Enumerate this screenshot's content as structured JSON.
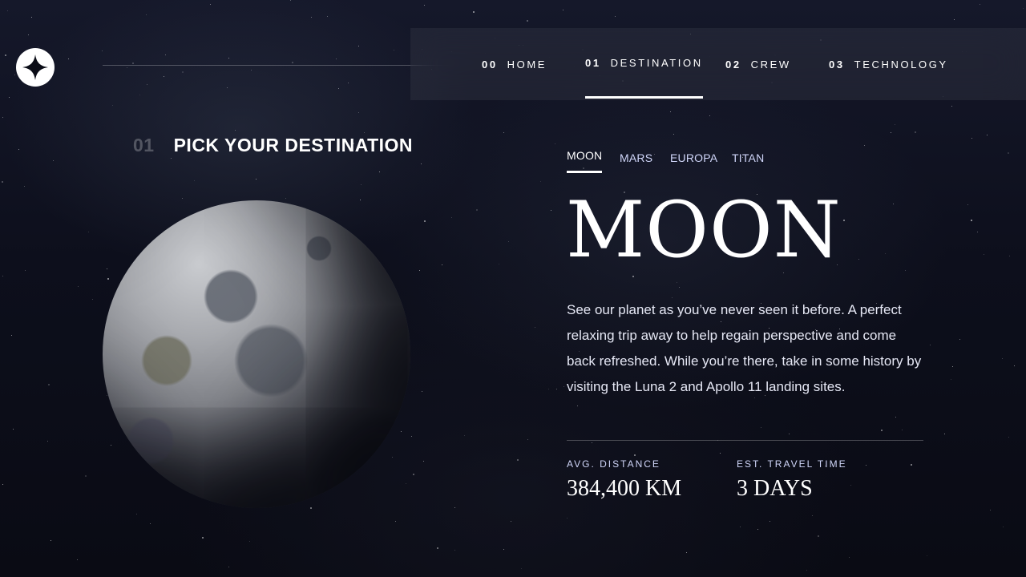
{
  "header": {
    "logo_icon": "star-logo-icon",
    "nav": [
      {
        "num": "00",
        "label": "HOME",
        "active": false
      },
      {
        "num": "01",
        "label": "DESTINATION",
        "active": true
      },
      {
        "num": "02",
        "label": "CREW",
        "active": false
      },
      {
        "num": "03",
        "label": "TECHNOLOGY",
        "active": false
      }
    ]
  },
  "page": {
    "section_num": "01",
    "section_title": "PICK YOUR DESTINATION"
  },
  "destination": {
    "tabs": [
      {
        "label": "MOON",
        "active": true
      },
      {
        "label": "MARS",
        "active": false
      },
      {
        "label": "EUROPA",
        "active": false
      },
      {
        "label": "TITAN",
        "active": false
      }
    ],
    "name": "MOON",
    "description": "See our planet as you’ve never seen it before. A perfect relaxing trip away to help regain perspective and come back refreshed. While you’re there, take in some history by visiting the Luna 2 and Apollo 11 landing sites.",
    "stats": [
      {
        "label": "AVG. DISTANCE",
        "value": "384,400 KM"
      },
      {
        "label": "EST. TRAVEL TIME",
        "value": "3 DAYS"
      }
    ]
  },
  "colors": {
    "background": "#0b0d17",
    "text": "#ffffff",
    "muted": "#d0d6f9"
  }
}
